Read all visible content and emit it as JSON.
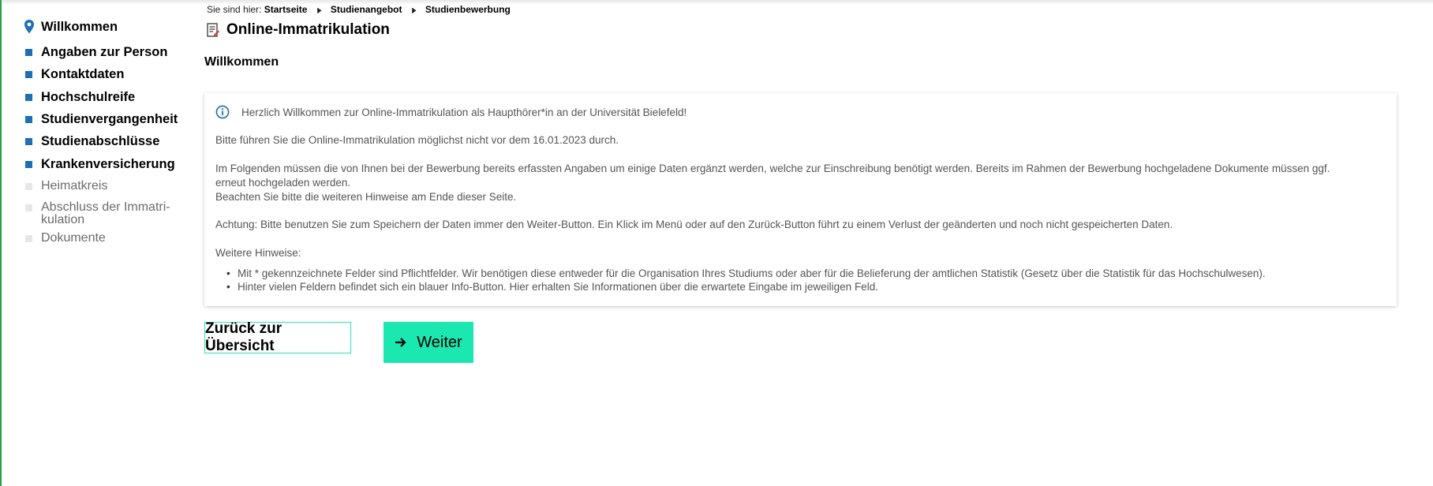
{
  "breadcrumb": {
    "prefix": "Sie sind hier:",
    "items": [
      "Startseite",
      "Studienangebot",
      "Studienbewerbung"
    ]
  },
  "page_title": "Online-Immatrikulation",
  "section_title": "Willkommen",
  "sidebar": {
    "items": [
      {
        "label": "Willkommen",
        "state": "current"
      },
      {
        "label": "Angaben zur Person",
        "state": "done"
      },
      {
        "label": "Kontaktdaten",
        "state": "done"
      },
      {
        "label": "Hochschulreife",
        "state": "done"
      },
      {
        "label": "Studienvergangenheit",
        "state": "done"
      },
      {
        "label": "Studienabschlüsse",
        "state": "done"
      },
      {
        "label": "Krankenversicherung",
        "state": "done"
      },
      {
        "label": "Heimatkreis",
        "state": "todo"
      },
      {
        "label": "Abschluss der Immatri-",
        "label2": "kulation",
        "state": "todo"
      },
      {
        "label": "Dokumente",
        "state": "todo"
      }
    ]
  },
  "info": {
    "welcome": "Herzlich Willkommen zur Online-Immatrikulation als Haupthörer*in an der Universität Bielefeld!",
    "date_note": "Bitte führen Sie die Online-Immatrikulation möglichst nicht vor dem 16.01.2023 durch.",
    "data_note_1": "Im Folgenden müssen die von Ihnen bei der Bewerbung bereits erfassten Angaben um einige Daten ergänzt werden, welche zur Einschreibung benötigt werden. Bereits im Rahmen der Bewerbung hochgeladene Dokumente müssen ggf.",
    "data_note_2": "erneut hochgeladen werden.",
    "data_note_3": "Beachten Sie bitte die weiteren Hinweise am Ende dieser Seite.",
    "attention": "Achtung: Bitte benutzen Sie zum Speichern der Daten immer den Weiter-Button. Ein Klick im Menü oder auf den Zurück-Button führt zu einem Verlust der geänderten und noch nicht gespeicherten Daten.",
    "further_heading": "Weitere Hinweise:",
    "further_items": [
      "Mit * gekennzeichnete Felder sind Pflichtfelder. Wir benötigen diese entweder für die Organisation Ihres Studiums oder aber für die Belieferung der amtlichen Statistik (Gesetz über die Statistik für das Hochschulwesen).",
      "Hinter vielen Feldern befindet sich ein blauer Info-Button. Hier erhalten Sie Informationen über die erwartete Eingabe im jeweiligen Feld."
    ]
  },
  "buttons": {
    "back": "Zurück zur Übersicht",
    "next": "Weiter"
  },
  "colors": {
    "accent": "#1be8b0",
    "nav_bullet_done": "#1f6fb2",
    "nav_bullet_todo": "#e6e6e6"
  }
}
